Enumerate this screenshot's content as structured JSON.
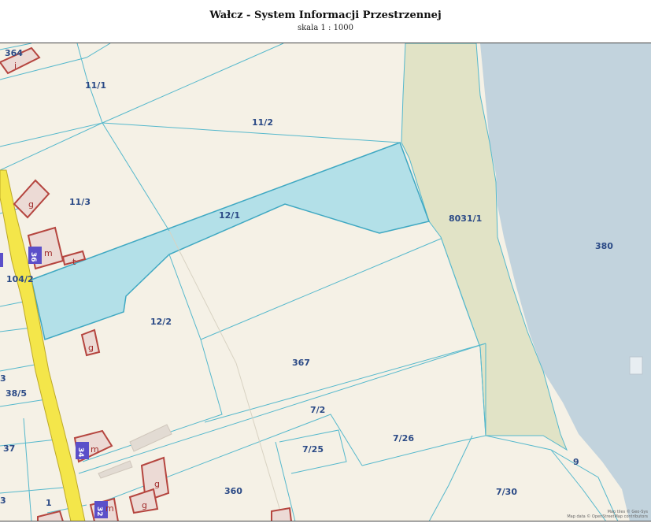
{
  "header": {
    "title": "Wałcz - System Informacji Przestrzennej",
    "scale": "skala 1 : 1000"
  },
  "colors": {
    "land": "#f5f1e6",
    "water": "#c2d3dd",
    "green_strip": "#e1e3c6",
    "highlight": "#b3e0e8",
    "parcel_line": "#55b8cc",
    "building_outline": "#b5453f",
    "building_fill": "#e9d7d2",
    "house_number_fill": "#5b4fc9",
    "road": "#f4e64a",
    "label": "#2b4a86"
  },
  "parcels": [
    {
      "id": "364"
    },
    {
      "id": "11/1"
    },
    {
      "id": "11/2"
    },
    {
      "id": "11/3"
    },
    {
      "id": "12/1"
    },
    {
      "id": "104/2"
    },
    {
      "id": "8031/1"
    },
    {
      "id": "380"
    },
    {
      "id": "12/2"
    },
    {
      "id": "367"
    },
    {
      "id": "3"
    },
    {
      "id": "38/5"
    },
    {
      "id": "37"
    },
    {
      "id": "7/2"
    },
    {
      "id": "7/26"
    },
    {
      "id": "7/25"
    },
    {
      "id": "9"
    },
    {
      "id": "360"
    },
    {
      "id": "7/30"
    },
    {
      "id": "1"
    },
    {
      "id": "3"
    }
  ],
  "building_labels": [
    {
      "text": "i"
    },
    {
      "text": "g"
    },
    {
      "text": "m"
    },
    {
      "text": "t"
    },
    {
      "text": "g"
    },
    {
      "text": "m"
    },
    {
      "text": "g"
    },
    {
      "text": "m"
    },
    {
      "text": "g"
    }
  ],
  "house_numbers": [
    {
      "text": "36"
    },
    {
      "text": "34"
    },
    {
      "text": "32"
    }
  ],
  "attribution": {
    "line1": "Map tiles © Geo-Sys",
    "line2": "Map data © OpenStreetMap contributors"
  }
}
